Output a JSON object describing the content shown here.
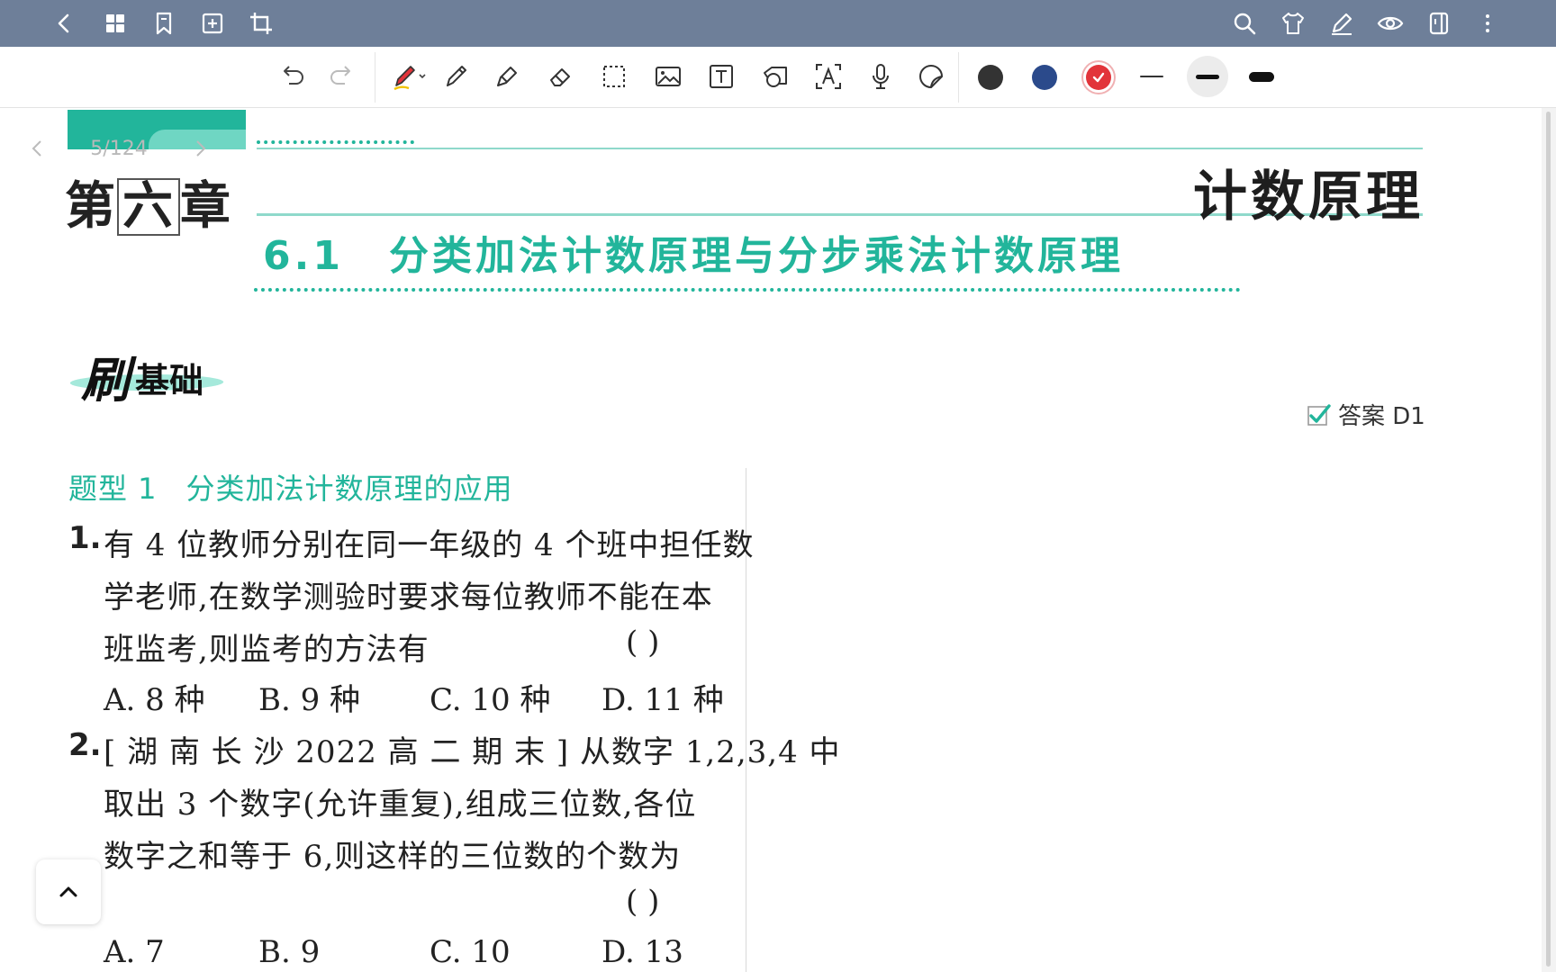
{
  "colors": {
    "topbar_bg": "#6e7f99",
    "accent_teal": "#22b59b",
    "pen_black": "#333333",
    "pen_blue": "#2b4a8b",
    "pen_red": "#e2343a"
  },
  "topbar": {
    "left_icons": [
      "back-icon",
      "grid-icon",
      "bookmark-icon",
      "add-page-icon",
      "crop-icon"
    ],
    "right_icons": [
      "search-icon",
      "shirt-icon",
      "pen-edit-icon",
      "eye-icon",
      "sidebar-icon",
      "more-vertical-icon"
    ]
  },
  "toolbar": {
    "tools": [
      "undo-icon",
      "redo-icon",
      "pen-icon",
      "pencil-icon",
      "highlighter-icon",
      "eraser-icon",
      "lasso-select-icon",
      "image-icon",
      "text-box-icon",
      "shape-icon",
      "text-recognition-icon",
      "microphone-icon",
      "sticker-icon"
    ],
    "colors": [
      "#333333",
      "#2b4a8b",
      "#e2343a"
    ],
    "selected_color": "#e2343a",
    "strokes": [
      "thin",
      "medium",
      "thick"
    ],
    "selected_stroke": "medium"
  },
  "document": {
    "page_indicator": "5/124",
    "chapter_pre": "第",
    "chapter_num": "六",
    "chapter_post": "章",
    "book_title": "计数原理",
    "section_number": "6.1",
    "section_title": "分类加法计数原理与分步乘法计数原理",
    "brush_char": "刷",
    "brush_sub": "基础",
    "answer_label": "答案 D1",
    "type_number": "题型 1",
    "type_title": "分类加法计数原理的应用",
    "questions": [
      {
        "number": "1.",
        "lines": [
          "有 4 位教师分别在同一年级的 4 个班中担任数",
          "学老师,在数学测验时要求每位教师不能在本",
          "班监考,则监考的方法有"
        ],
        "paren": "(      )",
        "options": [
          "A. 8 种",
          "B. 9 种",
          "C. 10 种",
          "D. 11 种"
        ]
      },
      {
        "number": "2.",
        "lines": [
          "[ 湖 南 长 沙 2022 高 二 期 末 ] 从数字 1,2,3,4 中",
          "取出 3 个数字(允许重复),组成三位数,各位",
          "数字之和等于 6,则这样的三位数的个数为"
        ],
        "paren": "(      )",
        "options": [
          "A. 7",
          "B. 9",
          "C. 10",
          "D. 13"
        ]
      }
    ]
  }
}
